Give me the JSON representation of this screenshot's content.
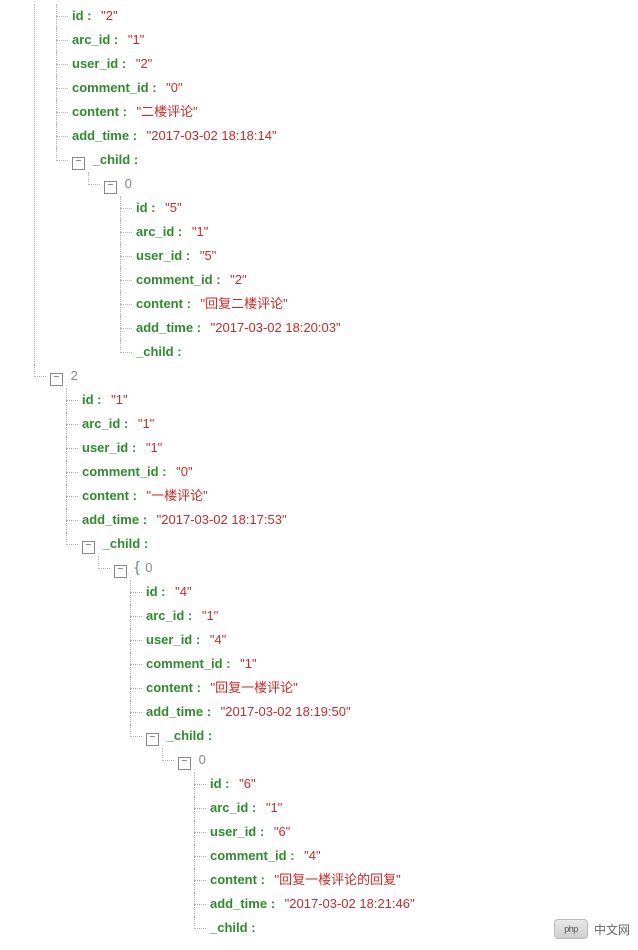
{
  "items": [
    {
      "index": null,
      "fields": {
        "id": "\"2\"",
        "arc_id": "\"1\"",
        "user_id": "\"2\"",
        "comment_id": "\"0\"",
        "content": "\"二楼评论\"",
        "add_time": "\"2017-03-02 18:18:14\""
      },
      "child": [
        {
          "index": "0",
          "fields": {
            "id": "\"5\"",
            "arc_id": "\"1\"",
            "user_id": "\"5\"",
            "comment_id": "\"2\"",
            "content": "\"回复二楼评论\"",
            "add_time": "\"2017-03-02 18:20:03\""
          },
          "child_empty": true
        }
      ]
    },
    {
      "index": "2",
      "fields": {
        "id": "\"1\"",
        "arc_id": "\"1\"",
        "user_id": "\"1\"",
        "comment_id": "\"0\"",
        "content": "\"一楼评论\"",
        "add_time": "\"2017-03-02 18:17:53\""
      },
      "child": [
        {
          "index": "0",
          "brace": true,
          "fields": {
            "id": "\"4\"",
            "arc_id": "\"1\"",
            "user_id": "\"4\"",
            "comment_id": "\"1\"",
            "content": "\"回复一楼评论\"",
            "add_time": "\"2017-03-02 18:19:50\""
          },
          "child": [
            {
              "index": "0",
              "fields": {
                "id": "\"6\"",
                "arc_id": "\"1\"",
                "user_id": "\"6\"",
                "comment_id": "\"4\"",
                "content": "\"回复一楼评论的回复\"",
                "add_time": "\"2017-03-02 18:21:46\""
              },
              "child_empty": true
            }
          ]
        }
      ]
    }
  ],
  "labels": {
    "id": "id",
    "arc_id": "arc_id",
    "user_id": "user_id",
    "comment_id": "comment_id",
    "content": "content",
    "add_time": "add_time",
    "child": "_child"
  },
  "watermark": {
    "logo_text": "php",
    "site_text": "中文网"
  }
}
